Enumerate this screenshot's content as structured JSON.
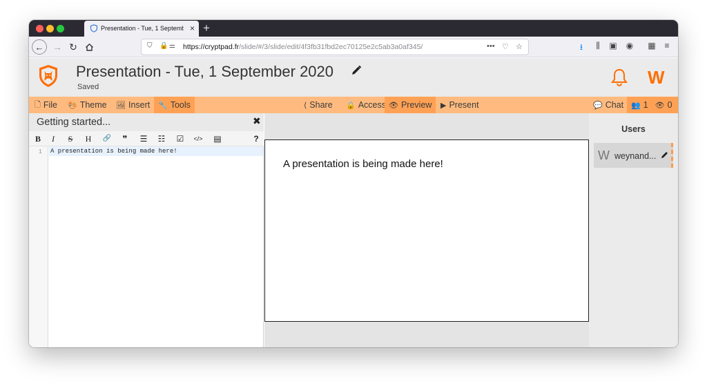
{
  "browser": {
    "tab_title": "Presentation - Tue, 1 Septembe",
    "tab_close": "×",
    "new_tab": "+",
    "url_host": "https://cryptpad.fr",
    "url_path": "/slide/#/3/slide/edit/4f3fb31fbd2ec70125e2c5ab3a0af345/",
    "url_dots": "•••"
  },
  "header": {
    "title": "Presentation - Tue, 1 September 2020",
    "status": "Saved",
    "avatar_letter": "W"
  },
  "toolbar": {
    "file": "File",
    "theme": "Theme",
    "insert": "Insert",
    "tools": "Tools",
    "share": "Share",
    "access": "Access",
    "preview": "Preview",
    "present": "Present",
    "chat": "Chat",
    "users_count": "1",
    "viewers_count": "0"
  },
  "editor": {
    "title": "Getting started...",
    "close": "✖",
    "md_buttons": {
      "bold": "B",
      "italic": "I",
      "strike": "S",
      "heading": "H",
      "link": "🔗",
      "quote": "❞",
      "ol": "☰",
      "ul": "☷",
      "check": "☑",
      "code": "</>",
      "table": "▤",
      "help": "?"
    },
    "line_number": "1",
    "code_text": "A presentation is being made here!"
  },
  "preview": {
    "slide_text": "A presentation is being made here!"
  },
  "users": {
    "title": "Users",
    "user_avatar": "W",
    "user_name": "weynand..."
  },
  "colors": {
    "accent": "#ff6e00",
    "toolbar_bg": "#ffbb7f",
    "toolbar_active": "#ffa154"
  }
}
